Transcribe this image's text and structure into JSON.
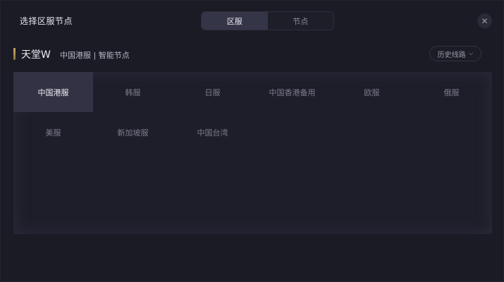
{
  "dialog": {
    "title": "选择区服节点",
    "close_glyph": "✕"
  },
  "segmented": {
    "items": [
      "区服",
      "节点"
    ],
    "active_index": 0
  },
  "game": {
    "name": "天堂W",
    "subtitle": "中国港服 | 智能节点"
  },
  "history": {
    "label": "历史线路",
    "icon": "chevron-down-icon"
  },
  "regions": {
    "items": [
      "中国港服",
      "韩服",
      "日服",
      "中国香港备用",
      "欧服",
      "俄服",
      "美服",
      "新加坡服",
      "中国台湾"
    ],
    "active_index": 0
  },
  "colors": {
    "accent_gold": "#caa865",
    "active_tab": "#353548",
    "active_region": "#323244"
  }
}
